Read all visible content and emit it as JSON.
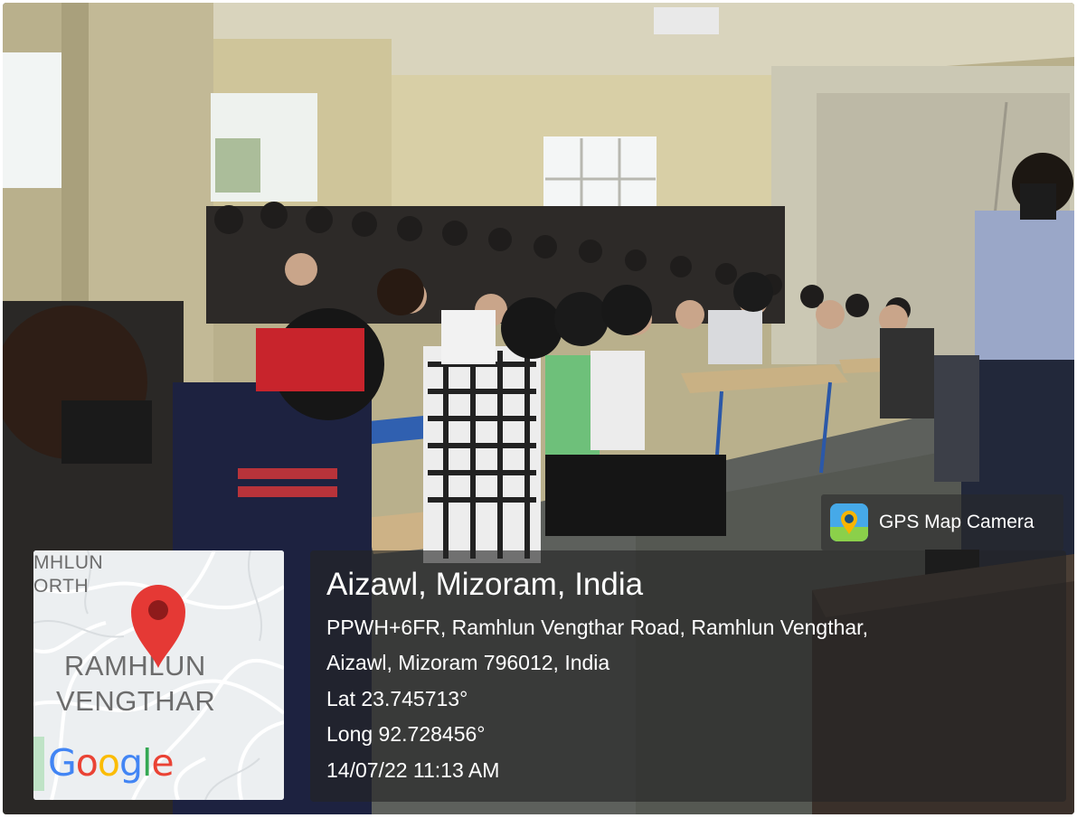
{
  "photo": {
    "description_icon": "classroom-photo"
  },
  "gps_badge": {
    "app_name": "GPS Map Camera",
    "icon": "gps-map-camera-app-icon"
  },
  "location": {
    "title": "Aizawl, Mizoram, India",
    "address_line1": "PPWH+6FR, Ramhlun Vengthar Road, Ramhlun Vengthar,",
    "address_line2": "Aizawl, Mizoram 796012, India",
    "latitude": "Lat 23.745713°",
    "longitude": "Long 92.728456°",
    "timestamp": "14/07/22 11:13 AM"
  },
  "map": {
    "label_north_1": "MHLUN",
    "label_north_2": "ORTH",
    "label_main_1": "RAMHLUN",
    "label_main_2": "VENGTHAR",
    "brand_letters": [
      "G",
      "o",
      "o",
      "g",
      "l",
      "e"
    ],
    "brand_colors": [
      "#4285F4",
      "#EA4335",
      "#FBBC05",
      "#4285F4",
      "#34A853",
      "#EA4335"
    ],
    "pin_color": "#E53935",
    "pin_icon": "map-pin-icon"
  }
}
